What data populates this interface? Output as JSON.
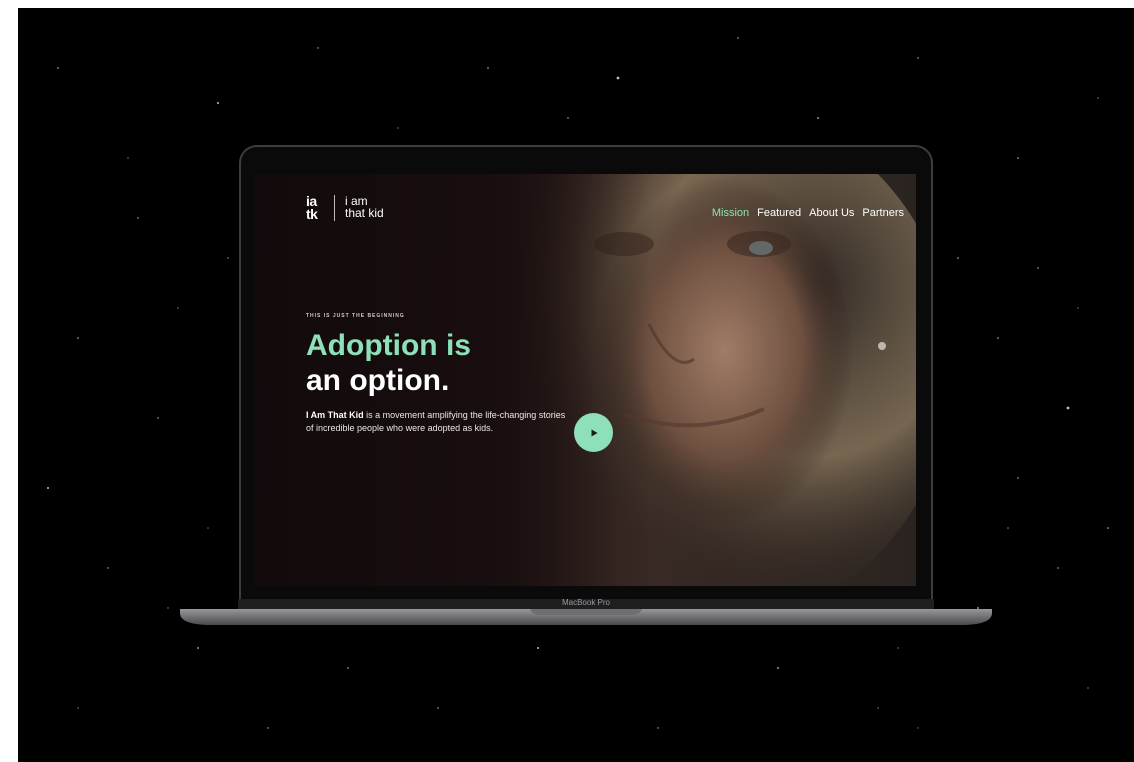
{
  "site": {
    "logo_mark_line1": "ia",
    "logo_mark_line2": "tk",
    "logo_text_line1": "i am",
    "logo_text_line2": "that kid"
  },
  "nav": {
    "items": [
      {
        "label": "Mission",
        "active": true
      },
      {
        "label": "Featured",
        "active": false
      },
      {
        "label": "About Us",
        "active": false
      },
      {
        "label": "Partners",
        "active": false
      }
    ]
  },
  "hero": {
    "eyebrow": "THIS IS JUST THE BEGINNING",
    "headline_line1": "Adoption is",
    "headline_line2": "an option.",
    "description_bold": "I Am That Kid",
    "description_rest": " is a movement amplifying the life-changing stories of incredible people who were adopted as kids.",
    "play_icon": "play-icon"
  },
  "device": {
    "label": "MacBook Pro"
  },
  "colors": {
    "accent": "#8ee0b8",
    "background": "#000000"
  }
}
